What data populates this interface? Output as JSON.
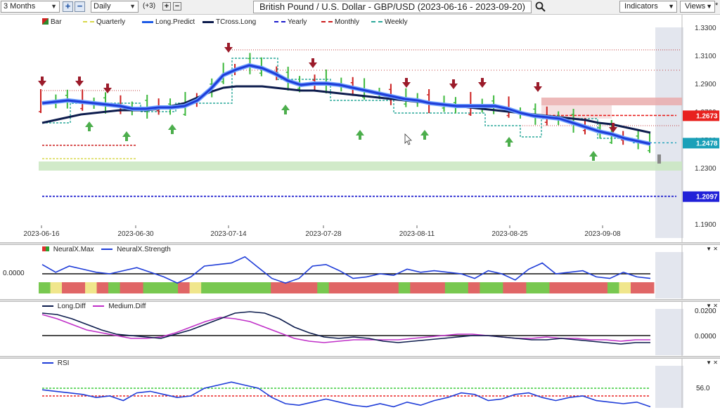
{
  "toolbar": {
    "period": "3 Months",
    "interval": "Daily",
    "plus_count": "(+3)",
    "title": "British Pound / U.S. Dollar - GBP/USD (2023-06-16 - 2023-09-20)",
    "indicators_label": "Indicators",
    "views_label": "Views",
    "search_icon": "magnifier-icon"
  },
  "main_legend": [
    {
      "label": "Bar",
      "color": "#2e8b2e"
    },
    {
      "label": "Quarterly",
      "color": "#d8d84a"
    },
    {
      "label": "Long.Predict",
      "color": "#1e5be6"
    },
    {
      "label": "TCross.Long",
      "color": "#0d1c4d"
    },
    {
      "label": "Yearly",
      "color": "#1a1acc"
    },
    {
      "label": "Monthly",
      "color": "#cc1a1a"
    },
    {
      "label": "Weekly",
      "color": "#2aa89a"
    }
  ],
  "price_axis": [
    "1.3300",
    "1.3100",
    "1.2900",
    "1.2700",
    "1.2500",
    "1.2300",
    "1.2100",
    "1.1900"
  ],
  "price_tags": [
    {
      "value": "1.2673",
      "color": "#e8211e"
    },
    {
      "value": "1.2478",
      "color": "#1aa0b8"
    },
    {
      "value": "1.2097",
      "color": "#2020d8"
    }
  ],
  "date_axis": [
    "2023-06-16",
    "2023-06-30",
    "2023-07-14",
    "2023-07-28",
    "2023-08-11",
    "2023-08-25",
    "2023-09-08"
  ],
  "chart_data": [
    {
      "type": "line",
      "title": "British Pound / U.S. Dollar - GBP/USD (2023-06-16 - 2023-09-20)",
      "series": [
        {
          "name": "Long.Predict",
          "values": [
            1.276,
            1.277,
            1.278,
            1.277,
            1.276,
            1.275,
            1.274,
            1.272,
            1.272,
            1.273,
            1.273,
            1.274,
            1.278,
            1.286,
            1.296,
            1.3,
            1.303,
            1.301,
            1.297,
            1.292,
            1.289,
            1.29,
            1.29,
            1.289,
            1.287,
            1.285,
            1.283,
            1.281,
            1.279,
            1.278,
            1.276,
            1.275,
            1.274,
            1.274,
            1.274,
            1.274,
            1.272,
            1.269,
            1.267,
            1.266,
            1.265,
            1.262,
            1.259,
            1.256,
            1.254,
            1.251,
            1.249,
            1.247
          ]
        },
        {
          "name": "TCross.Long",
          "values": [
            1.262,
            1.264,
            1.266,
            1.268,
            1.269,
            1.27,
            1.271,
            1.271,
            1.271,
            1.272,
            1.274,
            1.276,
            1.28,
            1.284,
            1.287,
            1.288,
            1.288,
            1.288,
            1.287,
            1.286,
            1.285,
            1.285,
            1.284,
            1.283,
            1.282,
            1.281,
            1.28,
            1.279,
            1.278,
            1.277,
            1.276,
            1.275,
            1.274,
            1.273,
            1.272,
            1.271,
            1.27,
            1.269,
            1.268,
            1.267,
            1.266,
            1.265,
            1.264,
            1.262,
            1.261,
            1.259,
            1.257,
            1.255
          ]
        }
      ],
      "levels": {
        "yearly": 1.2097,
        "monthly": 1.2673,
        "weekly": 1.2478
      },
      "ylim": [
        1.19,
        1.33
      ],
      "xlabel": "",
      "ylabel": "",
      "grid": false,
      "legend": "top-left"
    },
    {
      "type": "line",
      "series": [
        {
          "name": "NeuralX.Strength",
          "values": [
            0.6,
            0.1,
            0.5,
            0.3,
            0.1,
            0.0,
            0.2,
            0.4,
            0.1,
            -0.2,
            -0.6,
            -0.2,
            0.5,
            0.6,
            0.7,
            1.1,
            0.4,
            -0.3,
            -0.6,
            -0.3,
            0.5,
            0.6,
            0.2,
            -0.3,
            -0.2,
            0.0,
            -0.1,
            0.3,
            0.1,
            0.2,
            0.1,
            0.0,
            -0.3,
            0.2,
            0.0,
            -0.4,
            0.3,
            0.7,
            0.0,
            0.1,
            0.2,
            -0.2,
            -0.3,
            0.1,
            -0.2,
            -0.3
          ]
        }
      ],
      "y_ticks": [
        "0.0000"
      ],
      "legend_labels": [
        "NeuralX.Max",
        "NeuralX.Strength"
      ]
    },
    {
      "type": "line",
      "series": [
        {
          "name": "Long.Diff",
          "values": [
            0.016,
            0.015,
            0.012,
            0.008,
            0.004,
            0.001,
            0.0,
            -0.001,
            -0.002,
            0.001,
            0.004,
            0.008,
            0.012,
            0.016,
            0.017,
            0.016,
            0.012,
            0.006,
            0.002,
            -0.001,
            -0.002,
            -0.001,
            -0.002,
            -0.004,
            -0.005,
            -0.004,
            -0.003,
            -0.002,
            -0.001,
            0.0,
            0.0,
            -0.001,
            -0.002,
            -0.003,
            -0.003,
            -0.002,
            -0.003,
            -0.004,
            -0.005,
            -0.006,
            -0.005,
            -0.005
          ]
        },
        {
          "name": "Medium.Diff",
          "values": [
            0.015,
            0.012,
            0.008,
            0.004,
            0.002,
            0.0,
            -0.002,
            -0.002,
            -0.001,
            0.002,
            0.006,
            0.01,
            0.013,
            0.012,
            0.01,
            0.006,
            0.002,
            -0.002,
            -0.004,
            -0.005,
            -0.004,
            -0.003,
            -0.003,
            -0.003,
            -0.003,
            -0.002,
            -0.001,
            0.0,
            0.001,
            0.001,
            0.0,
            -0.001,
            -0.002,
            -0.002,
            -0.001,
            -0.002,
            -0.002,
            -0.003,
            -0.003,
            -0.004,
            -0.003,
            -0.003
          ]
        }
      ],
      "y_ticks": [
        "0.0200",
        "0.0000"
      ]
    },
    {
      "type": "line",
      "series": [
        {
          "name": "RSI",
          "values": [
            55,
            54,
            53,
            52,
            50,
            51,
            48,
            53,
            54,
            52,
            50,
            51,
            56,
            58,
            60,
            58,
            56,
            50,
            46,
            45,
            47,
            49,
            47,
            45,
            44,
            46,
            44,
            47,
            45,
            48,
            50,
            53,
            52,
            48,
            49,
            52,
            53,
            50,
            48,
            50,
            51,
            48,
            47,
            46,
            47,
            44
          ]
        }
      ],
      "y_ticks": [
        "56.0"
      ],
      "legend_labels": [
        "RSI"
      ]
    }
  ],
  "neural_bar_colors": [
    "#78c850",
    "#f0e68c",
    "#e06666",
    "#e06666",
    "#f0e68c",
    "#e06666",
    "#78c850",
    "#e06666",
    "#e06666",
    "#78c850",
    "#78c850",
    "#78c850",
    "#e06666",
    "#f0e68c",
    "#78c850",
    "#78c850",
    "#78c850",
    "#78c850",
    "#78c850",
    "#78c850",
    "#e06666",
    "#e06666",
    "#e06666",
    "#e06666",
    "#78c850",
    "#e06666",
    "#e06666",
    "#e06666",
    "#e06666",
    "#e06666",
    "#e06666",
    "#78c850",
    "#e06666",
    "#e06666",
    "#e06666",
    "#78c850",
    "#78c850",
    "#e06666",
    "#78c850",
    "#78c850",
    "#e06666",
    "#e06666",
    "#78c850",
    "#78c850",
    "#e06666",
    "#e06666",
    "#e06666",
    "#e06666",
    "#e06666",
    "#78c850",
    "#f0e68c",
    "#e06666",
    "#e06666"
  ],
  "lower_legends": {
    "diff": [
      "Long.Diff",
      "Medium.Diff"
    ]
  }
}
